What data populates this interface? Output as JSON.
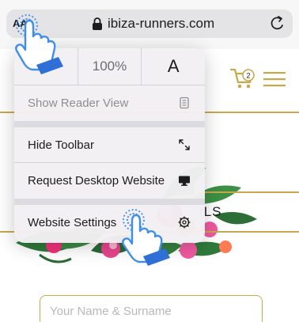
{
  "browser": {
    "text_size_button": "AA",
    "url": "ibiza-runners.com",
    "lock_icon": "lock-icon",
    "reload_icon": "reload-icon"
  },
  "site": {
    "partial_heading": "ILS",
    "cart_count": "2",
    "name_field_placeholder": "Your Name & Surname",
    "accent_color": "#c8a94a"
  },
  "menu": {
    "font_smaller": "A",
    "zoom": "100%",
    "font_larger": "A",
    "items": [
      {
        "label": "Show Reader View",
        "icon": "reader-view-icon",
        "enabled": false
      },
      {
        "label": "Hide Toolbar",
        "icon": "resize-arrows-icon",
        "enabled": true
      },
      {
        "label": "Request Desktop Website",
        "icon": "desktop-icon",
        "enabled": true
      },
      {
        "label": "Website Settings",
        "icon": "settings-gear-icon",
        "enabled": true
      }
    ]
  }
}
